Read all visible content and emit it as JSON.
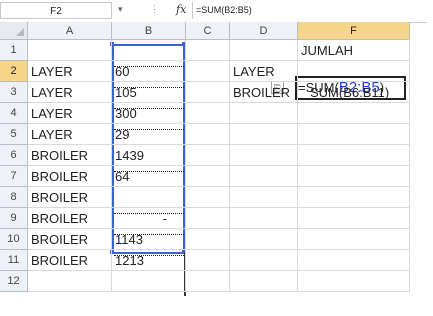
{
  "formula_bar": {
    "name_box": "F2",
    "fx_label": "fx",
    "formula": "=SUM(B2:B5)"
  },
  "columns": [
    "A",
    "B",
    "C",
    "D",
    "F"
  ],
  "rows": [
    "1",
    "2",
    "3",
    "4",
    "5",
    "6",
    "7",
    "8",
    "9",
    "10",
    "11",
    "12"
  ],
  "cells": {
    "A": [
      "",
      "LAYER",
      "LAYER",
      "LAYER",
      "LAYER",
      "BROILER",
      "BROILER",
      "BROILER",
      "BROILER",
      "BROILER",
      "BROILER",
      ""
    ],
    "B": [
      "",
      "60",
      "105",
      "300",
      "29",
      "1439",
      "64",
      "",
      "-",
      "1143",
      "1213",
      ""
    ],
    "D": [
      "",
      "LAYER",
      "BROILER",
      "",
      "",
      "",
      "",
      "",
      "",
      "",
      "",
      ""
    ],
    "F1": "JUMLAH",
    "F3": "SUM(B6:B11)"
  },
  "active_formula": {
    "prefix": "=SUM(",
    "ref": "B2:B5",
    "suffix": ")"
  },
  "colors": {
    "ref_highlight": "#3b63d6",
    "active_header": "#f6d58a"
  }
}
